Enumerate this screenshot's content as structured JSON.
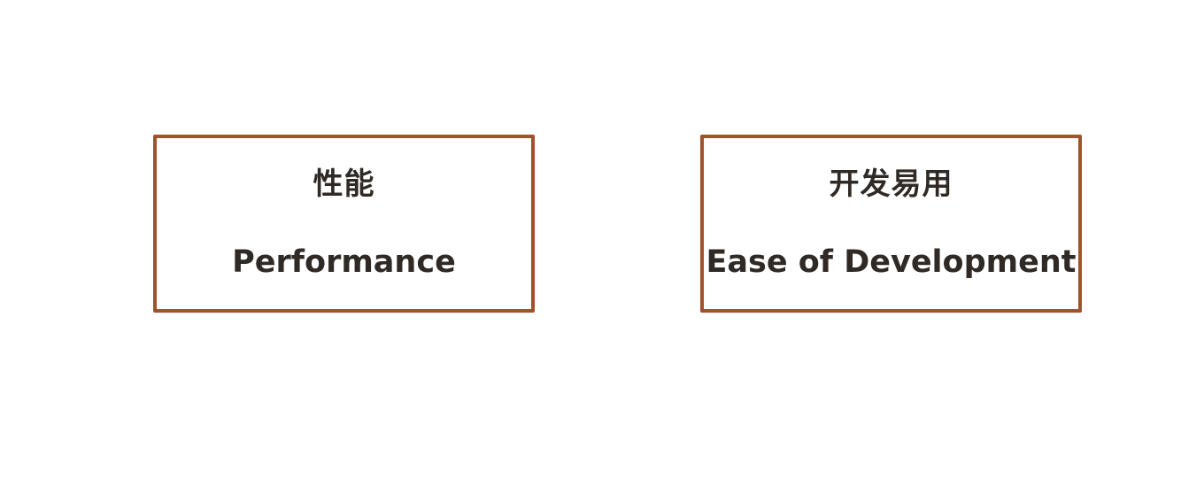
{
  "colors": {
    "border": "#A0522D",
    "text": "#2f2a26",
    "background": "#ffffff"
  },
  "boxes": [
    {
      "zh": "性能",
      "en": "Performance"
    },
    {
      "zh": "开发易用",
      "en": "Ease of Development"
    }
  ]
}
